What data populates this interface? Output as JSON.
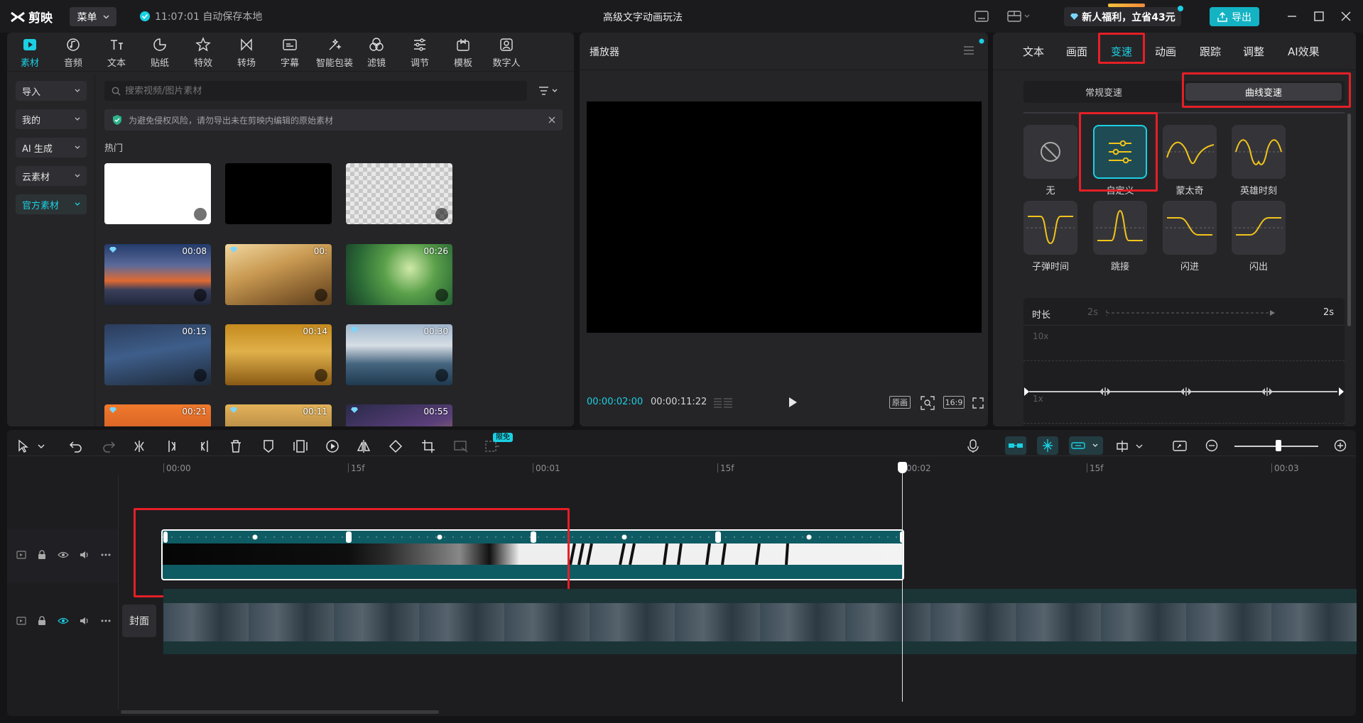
{
  "app": {
    "name": "剪映",
    "menu": "菜单",
    "autosave": "11:07:01 自动保存本地",
    "title": "高级文字动画玩法",
    "promo": "新人福利，立省43元",
    "export": "导出"
  },
  "colors": {
    "accent": "#1bd0e2",
    "highlight_box": "#e51f26",
    "clip_teal": "#0f5b63",
    "curve_yellow": "#f1c41a"
  },
  "toolbar_tabs": [
    {
      "label": "素材",
      "icon": "media-icon"
    },
    {
      "label": "音频",
      "icon": "audio-icon"
    },
    {
      "label": "文本",
      "icon": "text-icon"
    },
    {
      "label": "贴纸",
      "icon": "sticker-icon"
    },
    {
      "label": "特效",
      "icon": "effects-icon"
    },
    {
      "label": "转场",
      "icon": "transition-icon"
    },
    {
      "label": "字幕",
      "icon": "subtitle-icon"
    },
    {
      "label": "智能包装",
      "icon": "smart-pack-icon"
    },
    {
      "label": "滤镜",
      "icon": "filter-icon"
    },
    {
      "label": "调节",
      "icon": "adjust-icon"
    },
    {
      "label": "模板",
      "icon": "template-icon"
    },
    {
      "label": "数字人",
      "icon": "avatar-icon"
    }
  ],
  "side_nav": [
    "导入",
    "我的",
    "AI 生成",
    "云素材",
    "官方素材"
  ],
  "search": {
    "placeholder": "搜索视频/图片素材"
  },
  "notice": "为避免侵权风险，请勿导出未在剪映内编辑的原始素材",
  "section": "热门",
  "media_items": [
    {
      "duration": ""
    },
    {
      "duration": ""
    },
    {
      "duration": ""
    },
    {
      "duration": "00:08"
    },
    {
      "duration": "00:"
    },
    {
      "duration": "00:26"
    },
    {
      "duration": "00:15"
    },
    {
      "duration": "00:14"
    },
    {
      "duration": "00:30"
    },
    {
      "duration": "00:21"
    },
    {
      "duration": "00:11"
    },
    {
      "duration": "00:55"
    }
  ],
  "player": {
    "title": "播放器",
    "current_time": "00:00:02:00",
    "total_time": "00:00:11:22",
    "btn_original": "原画",
    "btn_ratio": "16:9"
  },
  "inspector": {
    "tabs": [
      "文本",
      "画面",
      "变速",
      "动画",
      "跟踪",
      "调整",
      "AI效果"
    ],
    "active_tab": "变速",
    "speed_modes": [
      "常规变速",
      "曲线变速"
    ],
    "curves": [
      "无",
      "自定义",
      "蒙太奇",
      "英雄时刻",
      "子弹时间",
      "跳接",
      "闪进",
      "闪出"
    ],
    "duration_label": "时长",
    "duration_from": "2s",
    "duration_to": "2s",
    "y_labels": [
      "10x",
      "1x"
    ]
  },
  "timeline": {
    "ruler": [
      "00:00",
      "15f",
      "00:01",
      "15f",
      "00:02",
      "15f",
      "00:03"
    ],
    "cover_label": "封面",
    "main_clip_label": "",
    "badge_free": "限免"
  }
}
